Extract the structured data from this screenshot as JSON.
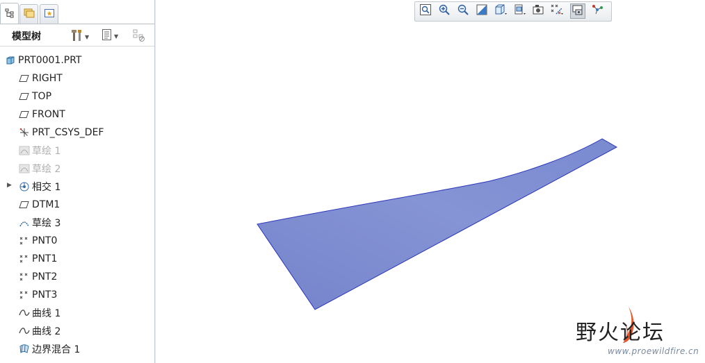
{
  "panel": {
    "title": "模型树"
  },
  "tree": {
    "items": [
      {
        "label": "PRT0001.PRT",
        "icon": "part-icon",
        "dim": false
      },
      {
        "label": "RIGHT",
        "icon": "datum-plane-icon",
        "dim": false
      },
      {
        "label": "TOP",
        "icon": "datum-plane-icon",
        "dim": false
      },
      {
        "label": "FRONT",
        "icon": "datum-plane-icon",
        "dim": false
      },
      {
        "label": "PRT_CSYS_DEF",
        "icon": "csys-icon",
        "dim": false
      },
      {
        "label": "草绘 1",
        "icon": "sketch-icon",
        "dim": true
      },
      {
        "label": "草绘 2",
        "icon": "sketch-icon",
        "dim": true
      },
      {
        "label": "相交 1",
        "icon": "intersect-icon",
        "dim": false
      },
      {
        "label": "DTM1",
        "icon": "datum-plane-icon",
        "dim": false
      },
      {
        "label": "草绘 3",
        "icon": "sketch-icon",
        "dim": false
      },
      {
        "label": "PNT0",
        "icon": "datum-point-icon",
        "dim": false
      },
      {
        "label": "PNT1",
        "icon": "datum-point-icon",
        "dim": false
      },
      {
        "label": "PNT2",
        "icon": "datum-point-icon",
        "dim": false
      },
      {
        "label": "PNT3",
        "icon": "datum-point-icon",
        "dim": false
      },
      {
        "label": "曲线 1",
        "icon": "curve-icon",
        "dim": false
      },
      {
        "label": "曲线 2",
        "icon": "curve-icon",
        "dim": false
      },
      {
        "label": "边界混合 1",
        "icon": "boundary-blend-icon",
        "dim": false
      }
    ]
  },
  "toolbar": {
    "buttons": [
      "refit-icon",
      "zoom-in-icon",
      "zoom-out-icon",
      "repaint-icon",
      "display-style-icon",
      "saved-views-icon",
      "view-manager-icon",
      "datum-display-icon",
      "annotation-display-icon",
      "spin-center-icon"
    ]
  },
  "watermark": {
    "main": "野火论坛",
    "url": "www.proewildfire.cn"
  },
  "colors": {
    "surface_fill": "#7f8ecf",
    "surface_edge": "#2a35b8",
    "dim_text": "#b0b0b0",
    "watermark_flame": "#e5572b"
  }
}
